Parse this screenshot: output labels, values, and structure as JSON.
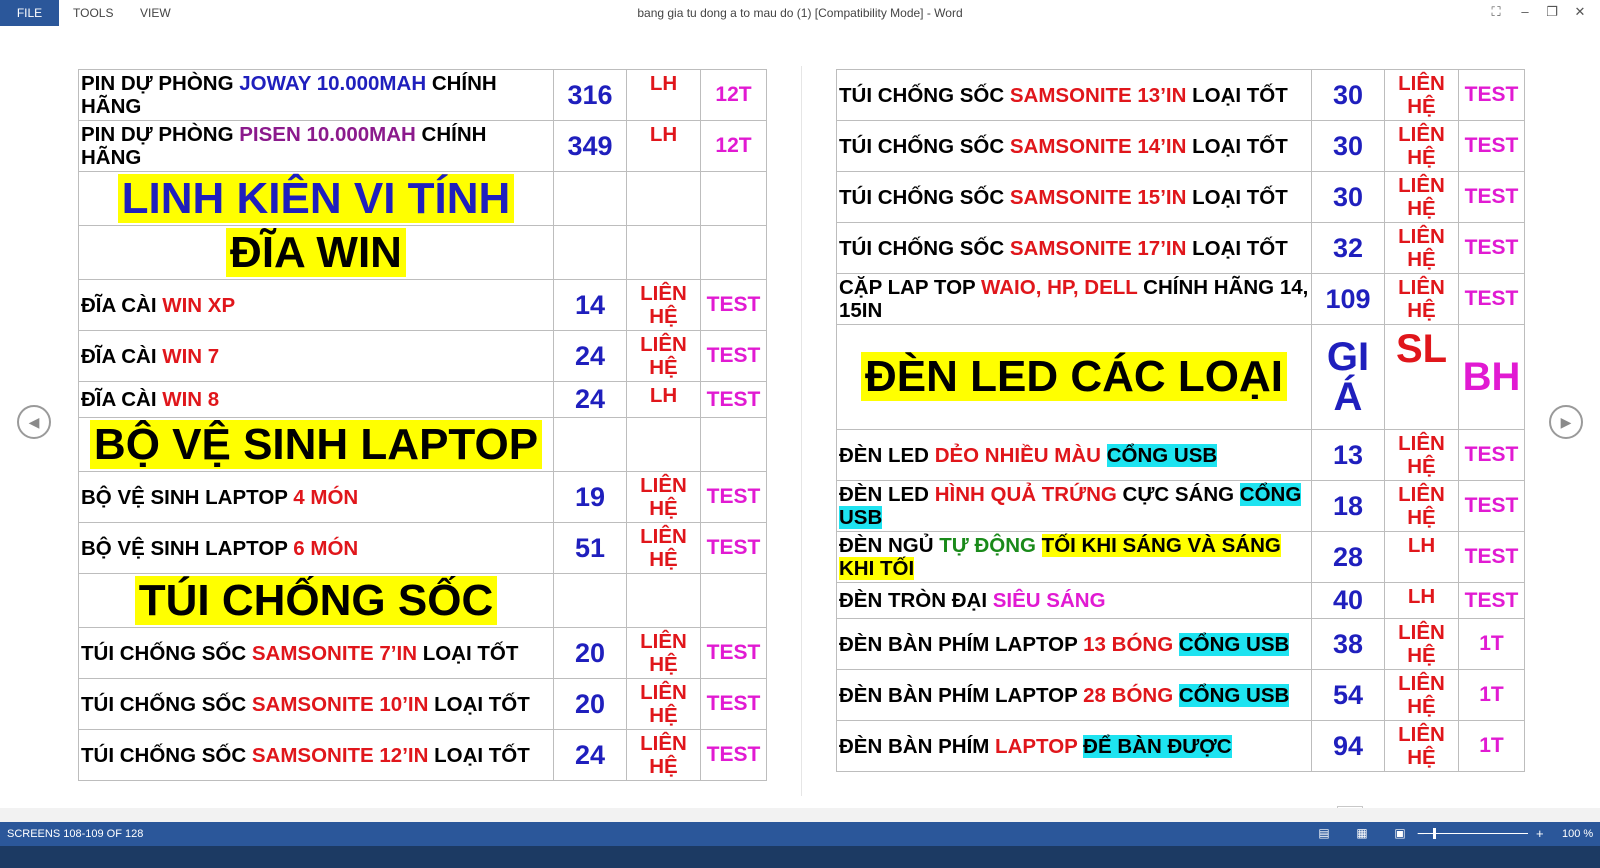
{
  "ribbon": {
    "file": "FILE",
    "tools": "TOOLS",
    "view": "VIEW"
  },
  "window_title": "bang gia tu dong a to mau do (1) [Compatibility Mode] - Word",
  "status": {
    "pages": "SCREENS 108-109 OF 128",
    "zoom": "100 %"
  },
  "left_rows": [
    {
      "type": "item",
      "segs": [
        [
          "PIN DỰ PHÒNG ",
          ""
        ],
        [
          "JOWAY 10.000MAH",
          "blue"
        ],
        [
          " CHÍNH HÃNG",
          ""
        ]
      ],
      "price": "316",
      "qty": "LH",
      "bh": "12T"
    },
    {
      "type": "item",
      "segs": [
        [
          "PIN DỰ PHÒNG ",
          ""
        ],
        [
          "PISEN 10.000MAH",
          "purple"
        ],
        [
          " CHÍNH HÃNG",
          ""
        ]
      ],
      "price": "349",
      "qty": "LH",
      "bh": "12T"
    },
    {
      "type": "section",
      "title": "LINH KIÊN VI TÍNH",
      "cls": "blue"
    },
    {
      "type": "section",
      "title": "ĐĨA WIN",
      "cls": ""
    },
    {
      "type": "item",
      "segs": [
        [
          "ĐĨA CÀI ",
          ""
        ],
        [
          "WIN XP",
          "red"
        ]
      ],
      "price": "14",
      "qty": "LIÊN HỆ",
      "bh": "TEST"
    },
    {
      "type": "item",
      "segs": [
        [
          "ĐĨA CÀI ",
          ""
        ],
        [
          "WIN 7",
          "red"
        ]
      ],
      "price": "24",
      "qty": "LIÊN HỆ",
      "bh": "TEST"
    },
    {
      "type": "item",
      "segs": [
        [
          "ĐĨA CÀI ",
          ""
        ],
        [
          "WIN 8",
          "red"
        ]
      ],
      "price": "24",
      "qty": "LH",
      "bh": "TEST"
    },
    {
      "type": "section",
      "title": "BỘ VỆ SINH LAPTOP",
      "cls": ""
    },
    {
      "type": "item",
      "segs": [
        [
          "BỘ VỆ SINH LAPTOP ",
          ""
        ],
        [
          "4 MÓN",
          "red"
        ]
      ],
      "price": "19",
      "qty": "LIÊN HỆ",
      "bh": "TEST"
    },
    {
      "type": "item",
      "segs": [
        [
          "BỘ VỆ SINH LAPTOP ",
          ""
        ],
        [
          "6 MÓN",
          "red"
        ]
      ],
      "price": "51",
      "qty": "LIÊN HỆ",
      "bh": "TEST"
    },
    {
      "type": "section",
      "title": "TÚI CHỐNG SỐC",
      "cls": ""
    },
    {
      "type": "item",
      "segs": [
        [
          "TÚI CHỐNG SỐC ",
          ""
        ],
        [
          "SAMSONITE 7’IN",
          "red"
        ],
        [
          "    LOẠI TỐT",
          ""
        ]
      ],
      "price": "20",
      "qty": "LIÊN HỆ",
      "bh": "TEST"
    },
    {
      "type": "item",
      "segs": [
        [
          "TÚI CHỐNG SỐC ",
          ""
        ],
        [
          "SAMSONITE 10’IN",
          "red"
        ],
        [
          "  LOẠI TỐT",
          ""
        ]
      ],
      "price": "20",
      "qty": "LIÊN HỆ",
      "bh": "TEST"
    },
    {
      "type": "item",
      "segs": [
        [
          "TÚI CHỐNG SỐC ",
          ""
        ],
        [
          "SAMSONITE 12’IN",
          "red"
        ],
        [
          "  LOẠI TỐT",
          ""
        ]
      ],
      "price": "24",
      "qty": "LIÊN HỆ",
      "bh": "TEST"
    }
  ],
  "right_rows": [
    {
      "type": "item",
      "segs": [
        [
          "TÚI CHỐNG SỐC ",
          ""
        ],
        [
          "SAMSONITE 13’IN",
          "red"
        ],
        [
          "  LOẠI TỐT",
          ""
        ]
      ],
      "price": "30",
      "qty": "LIÊN HỆ",
      "bh": "TEST"
    },
    {
      "type": "item",
      "segs": [
        [
          "TÚI CHỐNG SỐC ",
          ""
        ],
        [
          "SAMSONITE 14’IN",
          "red"
        ],
        [
          "  LOẠI TỐT",
          ""
        ]
      ],
      "price": "30",
      "qty": "LIÊN HỆ",
      "bh": "TEST"
    },
    {
      "type": "item",
      "segs": [
        [
          "TÚI CHỐNG SỐC ",
          ""
        ],
        [
          "SAMSONITE 15’IN",
          "red"
        ],
        [
          "  LOẠI TỐT",
          ""
        ]
      ],
      "price": "30",
      "qty": "LIÊN HỆ",
      "bh": "TEST"
    },
    {
      "type": "item",
      "segs": [
        [
          "TÚI CHỐNG SỐC ",
          ""
        ],
        [
          "SAMSONITE 17’IN",
          "red"
        ],
        [
          "  LOẠI TỐT",
          ""
        ]
      ],
      "price": "32",
      "qty": "LIÊN HỆ",
      "bh": "TEST"
    },
    {
      "type": "item",
      "segs": [
        [
          "CẶP LAP TOP ",
          ""
        ],
        [
          "WAIO, HP, DELL",
          "red"
        ],
        [
          " CHÍNH HÃNG 14, 15IN",
          ""
        ]
      ],
      "price": "109",
      "qty": "LIÊN HỆ",
      "bh": "TEST"
    },
    {
      "type": "header",
      "title": "ĐÈN LED CÁC LOẠI",
      "price": "GIÁ",
      "qty": "SL",
      "bh": "BH"
    },
    {
      "type": "item",
      "segs": [
        [
          "ĐÈN LED ",
          ""
        ],
        [
          "DẺO NHIỀU MÀU",
          "red"
        ],
        [
          " ",
          ""
        ],
        [
          "CỔNG USB",
          "cyanbg"
        ]
      ],
      "price": "13",
      "qty": "LIÊN HỆ",
      "bh": "TEST"
    },
    {
      "type": "item",
      "segs": [
        [
          "ĐÈN LED ",
          ""
        ],
        [
          "HÌNH QUẢ TRỨNG",
          "red"
        ],
        [
          " CỰC SÁNG ",
          ""
        ],
        [
          "CỔNG USB",
          "cyanbg"
        ]
      ],
      "price": "18",
      "qty": "LIÊN HỆ",
      "bh": "TEST"
    },
    {
      "type": "item",
      "segs": [
        [
          "ĐÈN NGỦ ",
          ""
        ],
        [
          "TỰ ĐỘNG",
          "green"
        ],
        [
          " ",
          ""
        ],
        [
          "TỐI KHI SÁNG VÀ SÁNG KHI TỐI",
          "yellowbg"
        ]
      ],
      "price": "28",
      "qty": "LH",
      "bh": "TEST"
    },
    {
      "type": "item",
      "segs": [
        [
          "ĐÈN TRÒN ĐẠI ",
          ""
        ],
        [
          "SIÊU SÁNG",
          "magenta"
        ]
      ],
      "price": "40",
      "qty": "LH",
      "bh": "TEST"
    },
    {
      "type": "item",
      "segs": [
        [
          "ĐÈN BÀN PHÍM LAPTOP ",
          ""
        ],
        [
          "13 BÓNG",
          "red"
        ],
        [
          " ",
          ""
        ],
        [
          "CỔNG USB",
          "cyanbg"
        ]
      ],
      "price": "38",
      "qty": "LIÊN HỆ",
      "bh": "1T"
    },
    {
      "type": "item",
      "segs": [
        [
          "ĐÈN BÀN PHÍM LAPTOP ",
          ""
        ],
        [
          "28 BÓNG",
          "red"
        ],
        [
          " ",
          ""
        ],
        [
          "CỔNG USB",
          "cyanbg"
        ]
      ],
      "price": "54",
      "qty": "LIÊN HỆ",
      "bh": "1T"
    },
    {
      "type": "item",
      "segs": [
        [
          "ĐÈN BÀN PHÍM ",
          ""
        ],
        [
          "LAPTOP",
          "red"
        ],
        [
          " ",
          ""
        ],
        [
          "ĐỂ BÀN ĐƯỢC",
          "cyanbg"
        ]
      ],
      "price": "94",
      "qty": "LIÊN HỆ",
      "bh": "1T"
    }
  ]
}
